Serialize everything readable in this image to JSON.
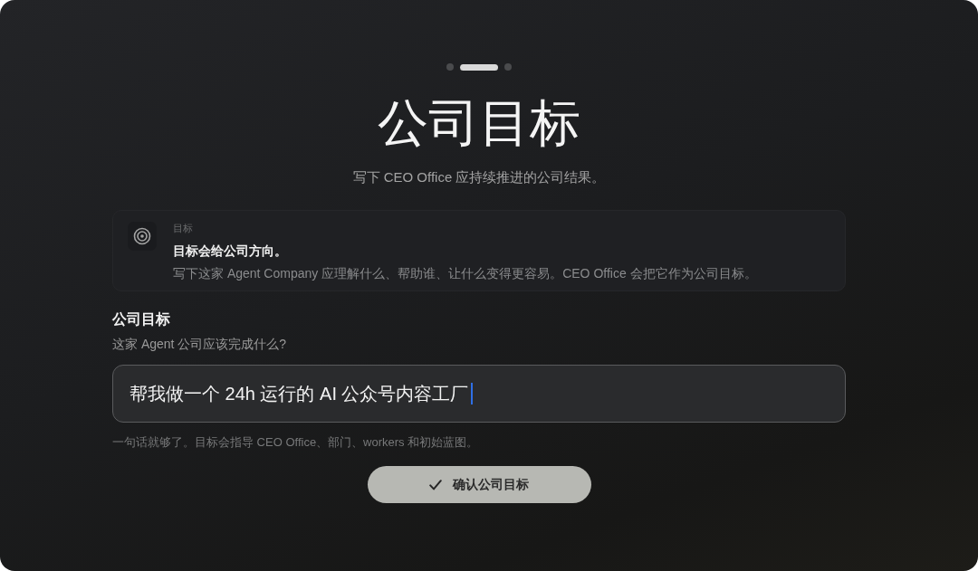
{
  "steps": [
    {
      "selected": false
    },
    {
      "selected": true
    },
    {
      "selected": false
    }
  ],
  "title": "公司目标",
  "subtitle": "写下 CEO Office 应持续推进的公司结果。",
  "info_card": {
    "eyebrow": "目标",
    "heading": "目标会给公司方向。",
    "text": "写下这家 Agent Company 应理解什么、帮助谁、让什么变得更容易。CEO Office 会把它作为公司目标。"
  },
  "goal_field": {
    "label": "公司目标",
    "question": "这家 Agent 公司应该完成什么?",
    "value": "帮我做一个 24h 运行的 AI 公众号内容工厂",
    "focused": true,
    "hint": "一句话就够了。目标会指导 CEO Office、部门、workers 和初始蓝图。"
  },
  "confirm_button": {
    "label": "确认公司目标"
  }
}
